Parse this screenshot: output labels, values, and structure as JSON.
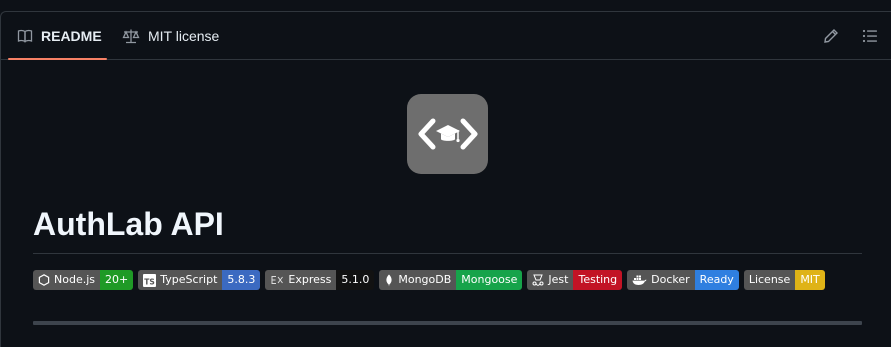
{
  "tabs": {
    "readme": "README",
    "license": "MIT license"
  },
  "readme": {
    "title": "AuthLab API",
    "badges": [
      {
        "label": "Node.js",
        "value": "20+",
        "color": "#1f9a26",
        "icon": "nodejs-icon"
      },
      {
        "label": "TypeScript",
        "value": "5.8.3",
        "color": "#3b6ac1",
        "icon": "typescript-icon"
      },
      {
        "label": "Express",
        "value": "5.1.0",
        "color": "#121212",
        "icon": "express-icon"
      },
      {
        "label": "MongoDB",
        "value": "Mongoose",
        "color": "#16a34a",
        "icon": "mongodb-icon"
      },
      {
        "label": "Jest",
        "value": "Testing",
        "color": "#c21325",
        "icon": "jest-icon"
      },
      {
        "label": "Docker",
        "value": "Ready",
        "color": "#2f7fe0",
        "icon": "docker-icon"
      },
      {
        "label": "License",
        "value": "MIT",
        "color": "#dfb317",
        "icon": ""
      }
    ]
  },
  "colors": {
    "background": "#0d1117",
    "border": "#30363d",
    "accent_underline": "#f78166",
    "logo_bg": "#6e6e6e"
  }
}
